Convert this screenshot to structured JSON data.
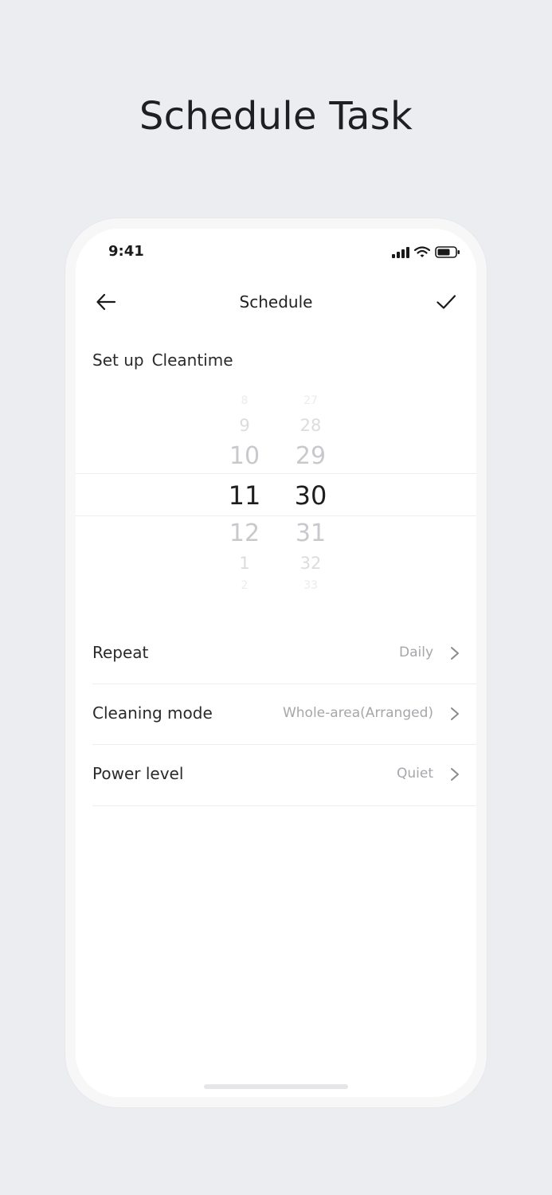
{
  "page": {
    "headline": "Schedule Task"
  },
  "status_bar": {
    "time": "9:41"
  },
  "nav": {
    "title": "Schedule"
  },
  "setup": {
    "prefix": "Set up",
    "name": "Cleantime"
  },
  "time_picker": {
    "hours": [
      "8",
      "9",
      "10",
      "11",
      "12",
      "1",
      "2"
    ],
    "minutes": [
      "27",
      "28",
      "29",
      "30",
      "31",
      "32",
      "33"
    ],
    "selected_hour": "11",
    "selected_minute": "30"
  },
  "settings": [
    {
      "label": "Repeat",
      "value": "Daily"
    },
    {
      "label": "Cleaning mode",
      "value": "Whole-area(Arranged)"
    },
    {
      "label": "Power level",
      "value": "Quiet"
    }
  ]
}
